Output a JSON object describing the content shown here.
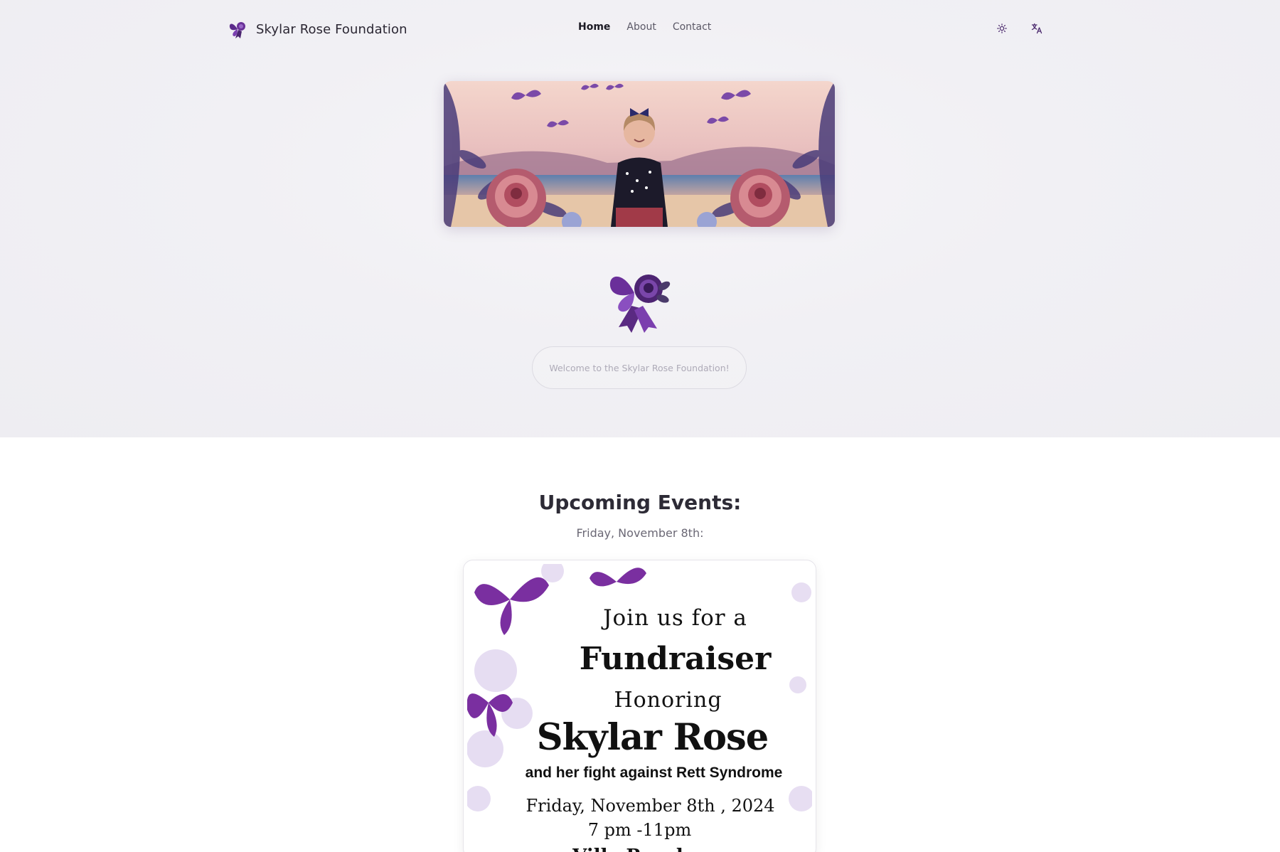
{
  "brand": {
    "name": "Skylar Rose Foundation",
    "logo_icon": "butterfly-rose-icon"
  },
  "nav": {
    "items": [
      {
        "label": "Home",
        "active": true
      },
      {
        "label": "About",
        "active": false
      },
      {
        "label": "Contact",
        "active": false
      }
    ]
  },
  "header_icons": {
    "theme": "sun-icon",
    "language": "translate-icon"
  },
  "hero": {
    "welcome_text": "Welcome to the Skylar Rose Foundation!"
  },
  "events": {
    "title": "Upcoming Events:",
    "date": "Friday, November 8th:",
    "flyer": {
      "line1": "Join us for a",
      "line2": "Fundraiser",
      "line3": "Honoring",
      "line4": "Skylar Rose",
      "line5": "and her fight against Rett Syndrome",
      "line6": "Friday, November 8th , 2024",
      "line7": "7 pm -11pm",
      "line8": "Villa Rosalee"
    }
  },
  "colors": {
    "accent": "#6b3fa0",
    "hero_bg": "#f1f0f4",
    "text": "#2d2b36"
  }
}
